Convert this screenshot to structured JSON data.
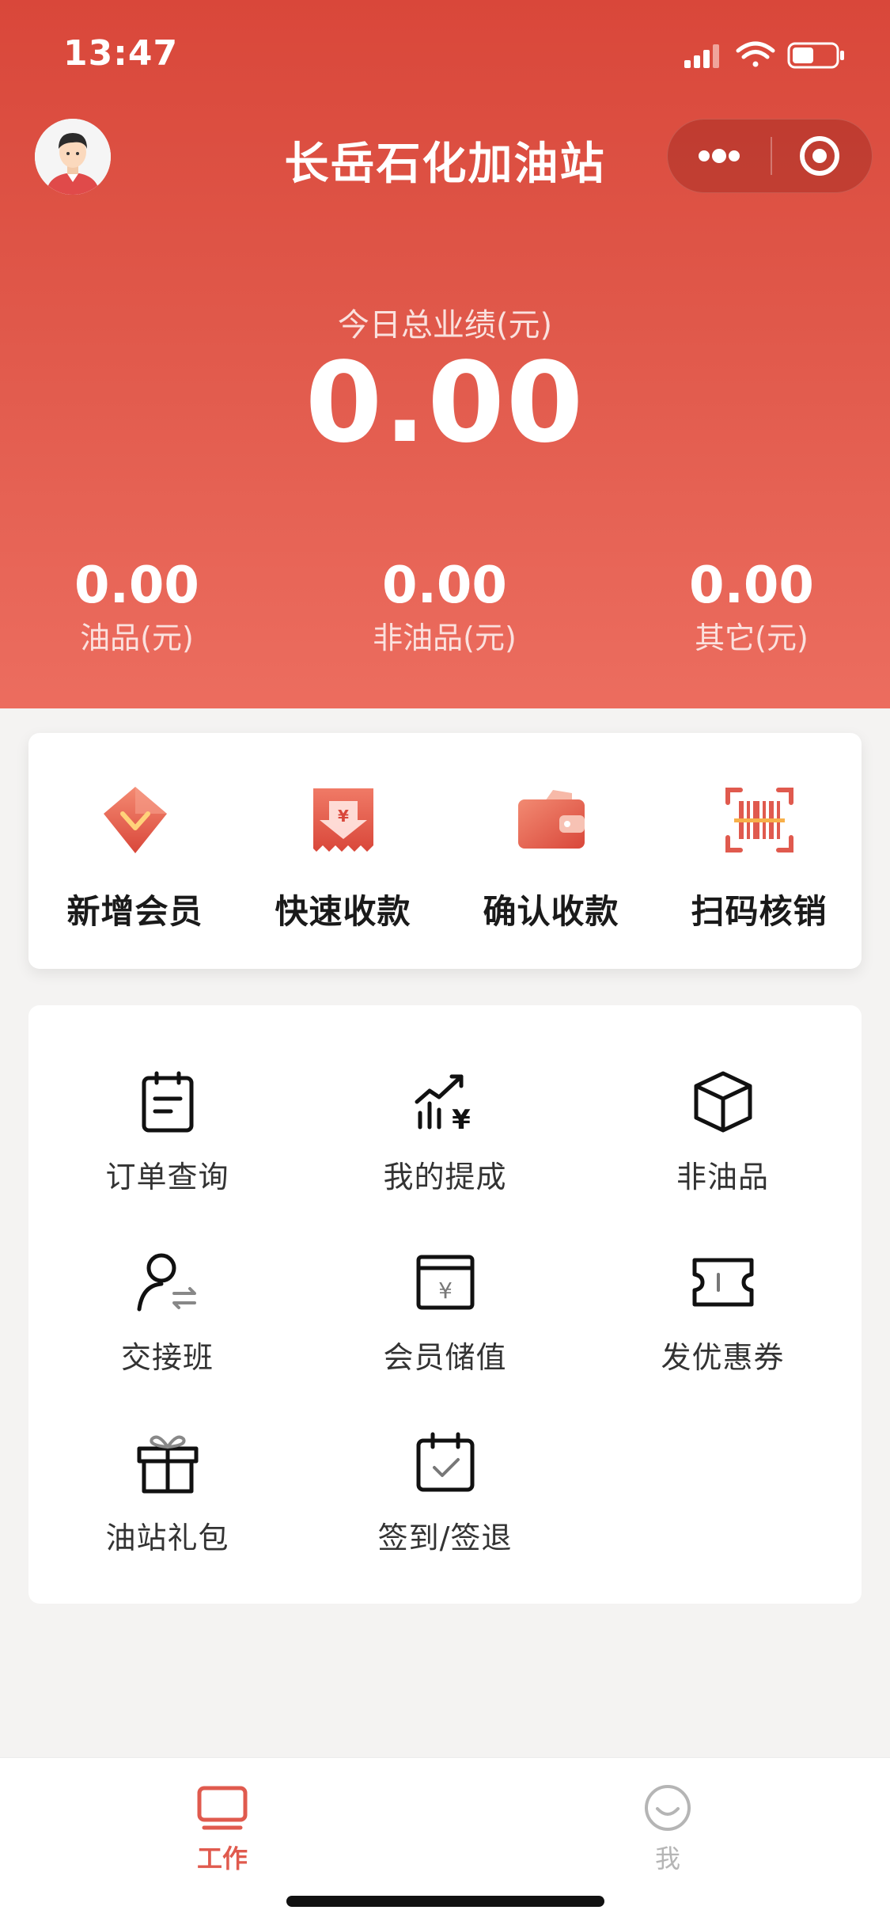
{
  "status_bar": {
    "time": "13:47",
    "icons": [
      "signal-icon",
      "wifi-icon",
      "battery-icon"
    ]
  },
  "header": {
    "title": "长岳石化加油站",
    "avatar": "avatar-icon",
    "capsule_icons": [
      "more-dots-icon",
      "close-target-icon"
    ]
  },
  "summary": {
    "total_label": "今日总业绩(元)",
    "total_value": "0.00",
    "stats": [
      {
        "value": "0.00",
        "label": "油品(元)"
      },
      {
        "value": "0.00",
        "label": "非油品(元)"
      },
      {
        "value": "0.00",
        "label": "其它(元)"
      }
    ]
  },
  "quick_actions": [
    {
      "label": "新增会员",
      "icon": "member-diamond-icon"
    },
    {
      "label": "快速收款",
      "icon": "quick-receipt-icon"
    },
    {
      "label": "确认收款",
      "icon": "wallet-icon"
    },
    {
      "label": "扫码核销",
      "icon": "barcode-scan-icon"
    }
  ],
  "grid_items": [
    {
      "label": "订单查询",
      "icon": "order-clipboard-icon"
    },
    {
      "label": "我的提成",
      "icon": "commission-chart-icon"
    },
    {
      "label": "非油品",
      "icon": "box-icon"
    },
    {
      "label": "交接班",
      "icon": "shift-handover-icon"
    },
    {
      "label": "会员储值",
      "icon": "member-deposit-icon"
    },
    {
      "label": "发优惠券",
      "icon": "coupon-icon"
    },
    {
      "label": "油站礼包",
      "icon": "gift-icon"
    },
    {
      "label": "签到/签退",
      "icon": "calendar-check-icon"
    }
  ],
  "tabbar": {
    "tabs": [
      {
        "label": "工作",
        "icon": "monitor-icon",
        "active": true
      },
      {
        "label": "我",
        "icon": "smile-icon",
        "active": false
      }
    ]
  },
  "colors": {
    "brand": "#d9473a",
    "active_tab": "#e05a4e",
    "inactive_tab": "#b5b5b5"
  }
}
